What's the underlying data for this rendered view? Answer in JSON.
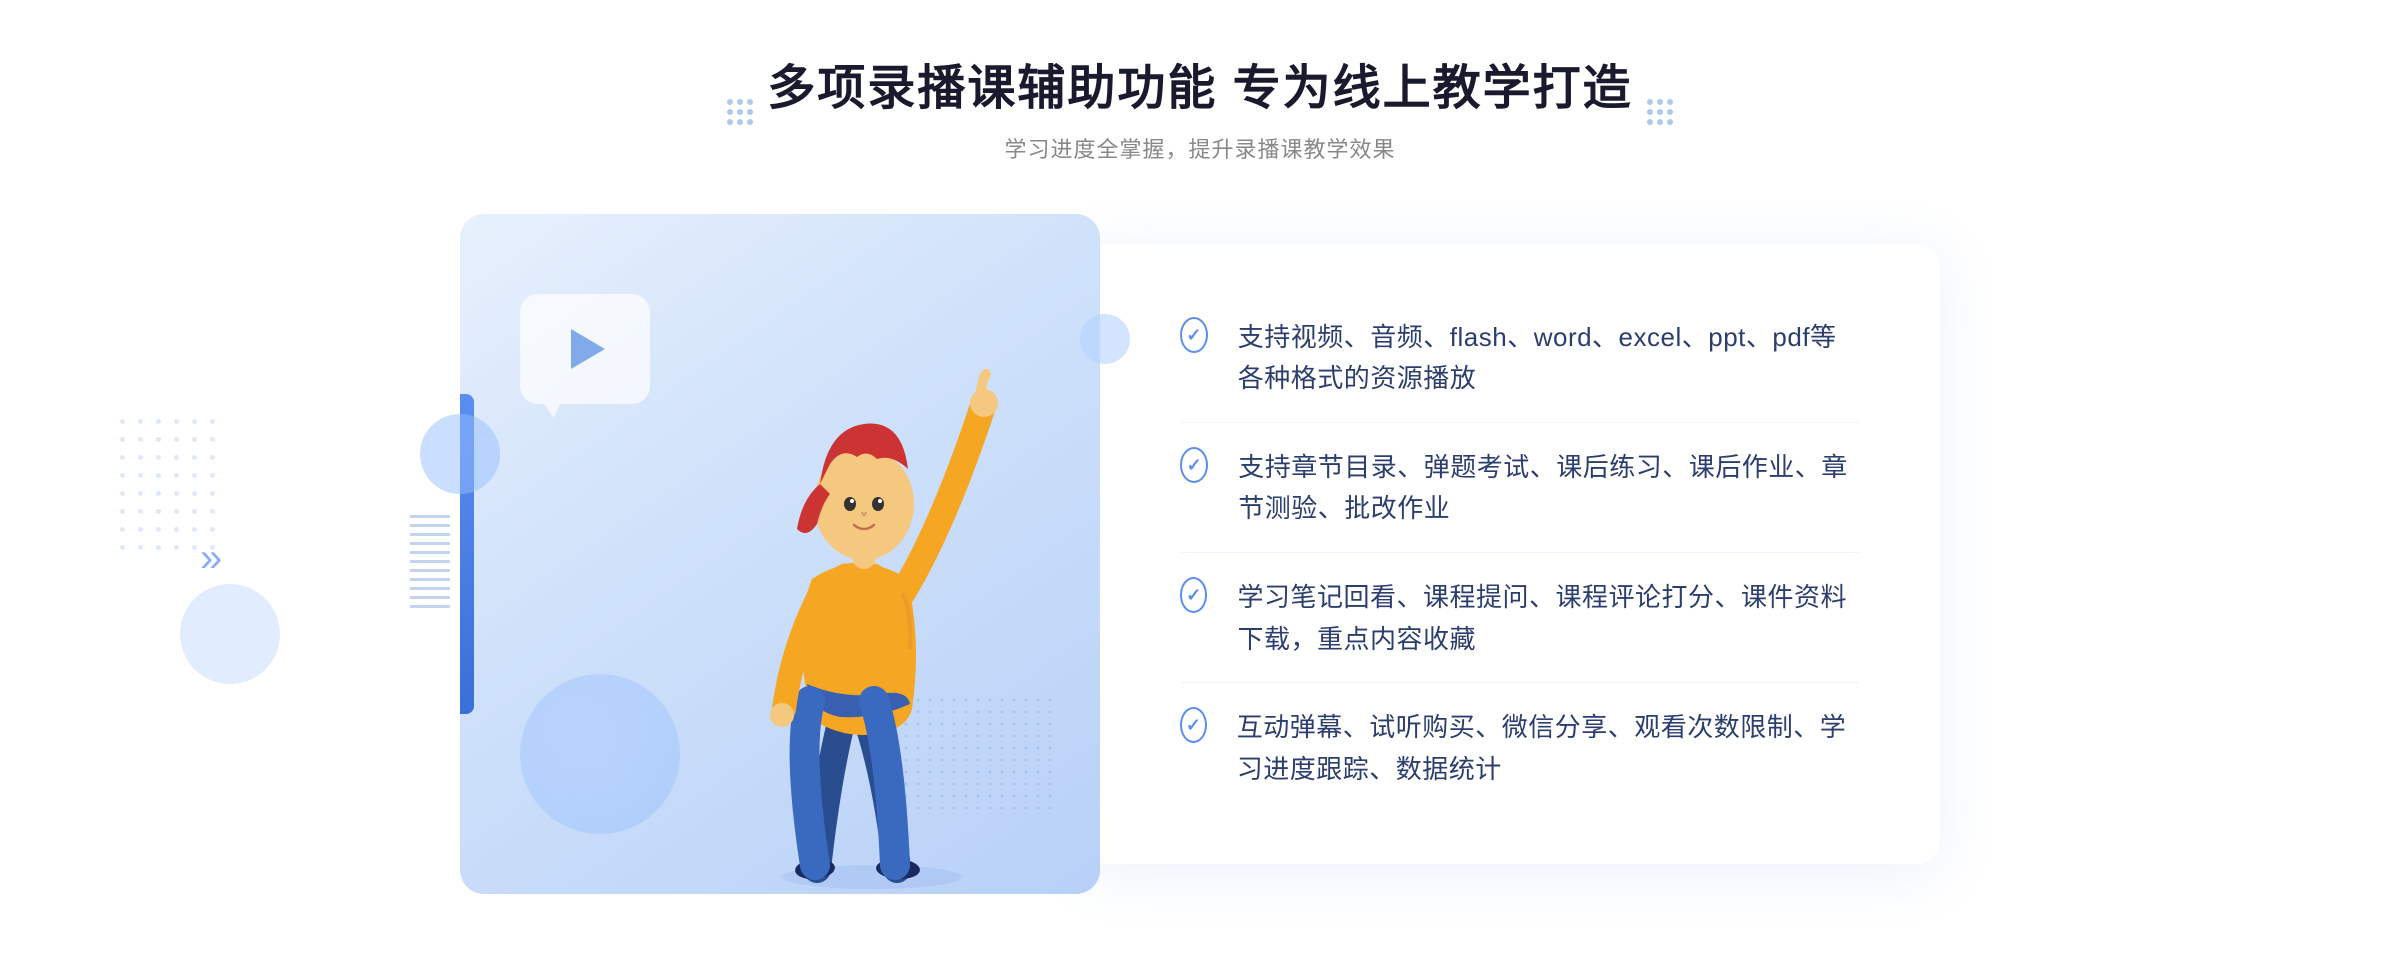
{
  "header": {
    "title": "多项录播课辅助功能 专为线上教学打造",
    "subtitle": "学习进度全掌握，提升录播课教学效果"
  },
  "features": [
    {
      "id": "feature-1",
      "text": "支持视频、音频、flash、word、excel、ppt、pdf等各种格式的资源播放"
    },
    {
      "id": "feature-2",
      "text": "支持章节目录、弹题考试、课后练习、课后作业、章节测验、批改作业"
    },
    {
      "id": "feature-3",
      "text": "学习笔记回看、课程提问、课程评论打分、课件资料下载，重点内容收藏"
    },
    {
      "id": "feature-4",
      "text": "互动弹幕、试听购买、微信分享、观看次数限制、学习进度跟踪、数据统计"
    }
  ],
  "illustration": {
    "play_label": "play",
    "chevron_symbol": "»"
  }
}
